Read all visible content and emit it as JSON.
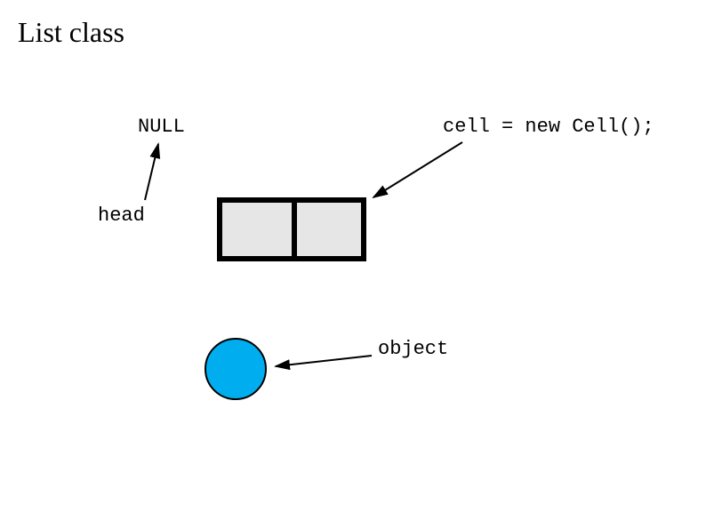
{
  "title": "List class",
  "labels": {
    "null": "NULL",
    "cell": "cell = new Cell();",
    "head": "head",
    "object": "object"
  }
}
